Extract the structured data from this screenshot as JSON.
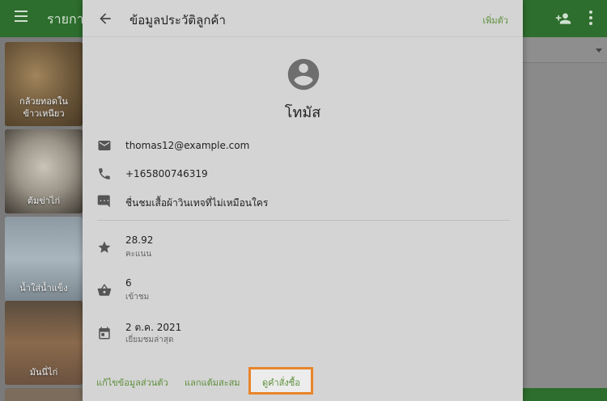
{
  "background": {
    "appbar_title": "รายการ",
    "tiles": [
      {
        "label": "กล้วยทอดใน\nข้าวเหนียว"
      },
      {
        "label": "ต้มข่าไก่"
      },
      {
        "label": "น้ำใส่น้ำแข็ง"
      },
      {
        "label": "มันนี่ไก่"
      }
    ]
  },
  "dialog": {
    "title": "ข้อมูลประวัติลูกค้า",
    "follow_label": "เพิ่มตัว",
    "customer_name": "โทมัส",
    "email": "thomas12@example.com",
    "phone": "+165800746319",
    "note": "ชื่นชมเสื้อผ้าวินเทจที่ไม่เหมือนใคร",
    "score_value": "28.92",
    "score_label": "คะแนน",
    "visits_value": "6",
    "visits_label": "เข้าชม",
    "last_visit_value": "2 ต.ค. 2021",
    "last_visit_label": "เยี่ยมชมล่าสุด",
    "actions": {
      "edit_label": "แก้ไขข้อมูลส่วนตัว",
      "points_label": "แลกแต้มสะสม",
      "orders_label": "ดูคำสั่งซื้อ"
    }
  },
  "colors": {
    "accent_green": "#5d8f3a",
    "appbar_green": "#2d6d2d",
    "highlight_orange": "#e8852a"
  },
  "icons": [
    "back-arrow-icon",
    "account-circle-icon",
    "email-icon",
    "phone-icon",
    "comment-icon",
    "star-icon",
    "basket-icon",
    "calendar-icon",
    "menu-icon",
    "person-add-icon",
    "more-vert-icon"
  ]
}
